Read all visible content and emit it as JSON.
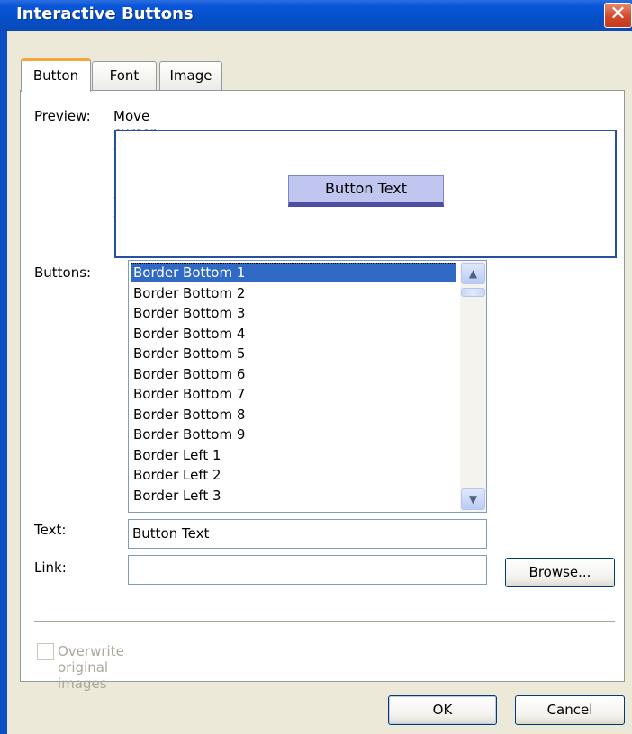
{
  "window": {
    "title": "Interactive Buttons",
    "close_glyph": "✕"
  },
  "tabs": [
    {
      "label": "Button",
      "active": true
    },
    {
      "label": "Font",
      "active": false
    },
    {
      "label": "Image",
      "active": false
    }
  ],
  "preview": {
    "label": "Preview:",
    "hint": "Move cursor over button and click for sample.",
    "sample_text": "Button Text"
  },
  "buttons": {
    "label": "Buttons:",
    "items": [
      "Border Bottom 1",
      "Border Bottom 2",
      "Border Bottom 3",
      "Border Bottom 4",
      "Border Bottom 5",
      "Border Bottom 6",
      "Border Bottom 7",
      "Border Bottom 8",
      "Border Bottom 9",
      "Border Left 1",
      "Border Left 2",
      "Border Left 3"
    ],
    "selected_index": 0
  },
  "text_field": {
    "label": "Text:",
    "value": "Button Text"
  },
  "link_field": {
    "label": "Link:",
    "value": ""
  },
  "browse_label": "Browse...",
  "overwrite": {
    "label": "Overwrite original images",
    "checked": false,
    "enabled": false
  },
  "footer": {
    "ok_label": "OK",
    "cancel_label": "Cancel"
  },
  "colors": {
    "titlebar": "#0350c8",
    "selection": "#316ac5",
    "active_tab_accent": "#f6a63c",
    "sample_button_bg": "#c0c6f0"
  },
  "icons": {
    "close": "close-icon",
    "scroll_up": "chevron-up-icon",
    "scroll_down": "chevron-down-icon"
  }
}
